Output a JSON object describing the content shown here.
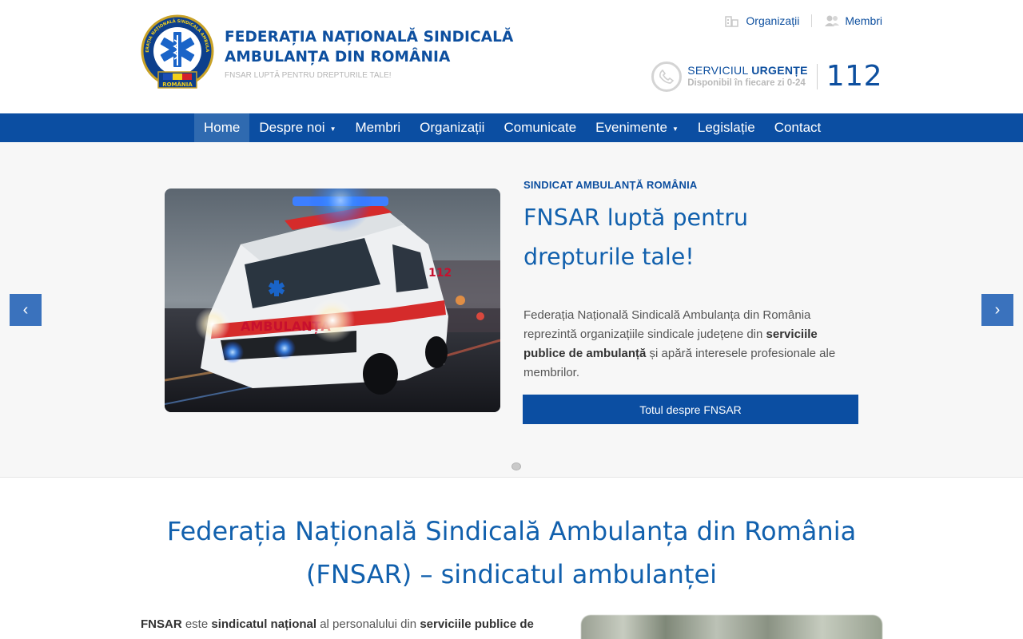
{
  "header": {
    "title_line1": "FEDERAȚIA NAȚIONALĂ SINDICALĂ",
    "title_line2": "AMBULANȚA DIN ROMÂNIA",
    "tagline": "FNSAR LUPTĂ PENTRU DREPTURILE TALE!",
    "logo_text_top": "FEDERAȚIA NAȚIONALĂ SINDICALĂ AMBULANȚA",
    "logo_text_bottom": "ROMÂNIA",
    "toplinks": [
      {
        "label": "Organizații",
        "icon": "building-icon"
      },
      {
        "label": "Membri",
        "icon": "users-icon"
      }
    ],
    "urgent": {
      "label_normal": "SERVICIUL ",
      "label_bold": "URGENȚE",
      "subtitle": "Disponibil în fiecare zi 0-24",
      "number": "112"
    }
  },
  "nav": {
    "items": [
      {
        "label": "Home",
        "active": true
      },
      {
        "label": "Despre noi",
        "dropdown": true
      },
      {
        "label": "Membri"
      },
      {
        "label": "Organizații"
      },
      {
        "label": "Comunicate"
      },
      {
        "label": "Evenimente",
        "dropdown": true
      },
      {
        "label": "Legislație"
      },
      {
        "label": "Contact"
      }
    ]
  },
  "hero": {
    "kicker": "SINDICAT AMBULANȚĂ ROMÂNIA",
    "title": "FNSAR luptă pentru drepturile tale!",
    "desc_1": "Federația Națională Sindicală Ambulanța din România reprezintă organizațiile sindicale județene din ",
    "desc_bold": "serviciile publice de ambulanță",
    "desc_2": " și apără interesele profesionale ale membrilor.",
    "button": "Totul despre FNSAR",
    "prev": "‹",
    "next": "›",
    "image_van_text": "AMBULANȚA",
    "image_van_number": "112"
  },
  "intro": {
    "title": "Federația Națională Sindicală Ambulanța din România (FNSAR) – sindicatul ambulanței",
    "t1": "FNSAR",
    "t2": " este ",
    "t3": "sindicatul național",
    "t4": " al personalului din ",
    "t5": "serviciile publice de"
  },
  "colors": {
    "brand_blue": "#0b4ea2",
    "title_blue": "#1160ad",
    "active_nav": "#2f6ab0"
  }
}
